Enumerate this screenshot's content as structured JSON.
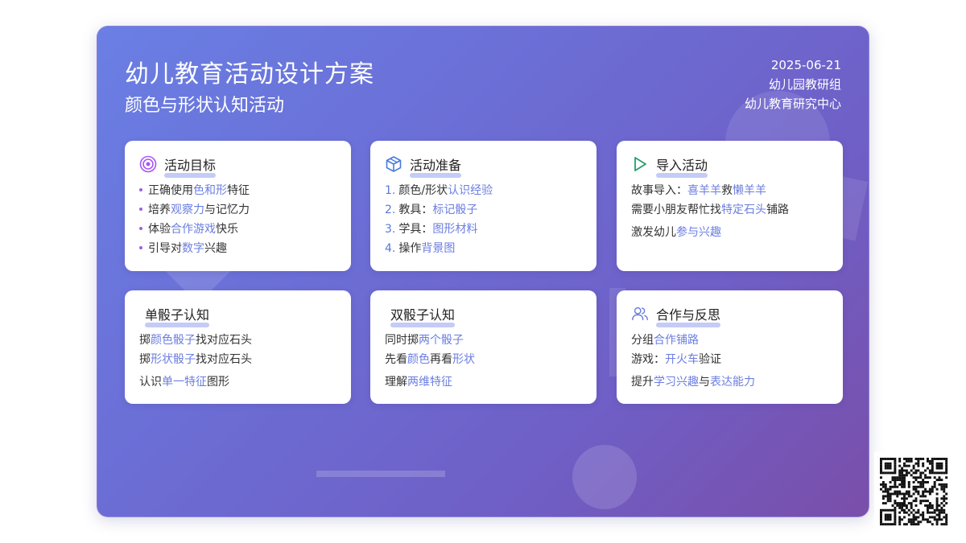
{
  "header": {
    "title": "幼儿教育活动设计方案",
    "subtitle": "颜色与形状认知活动",
    "date": "2025-06-21",
    "org": "幼儿园教研组",
    "center": "幼儿教育研究中心"
  },
  "cards": [
    {
      "title": "活动目标",
      "icon": "target-icon",
      "lines": [
        {
          "pre": "正确使用",
          "hl": "色和形",
          "post": "特征"
        },
        {
          "pre": "培养",
          "hl": "观察力",
          "post": "与记忆力"
        },
        {
          "pre": "体验",
          "hl": "合作游戏",
          "post": "快乐"
        },
        {
          "pre": "引导对",
          "hl": "数字",
          "post": "兴趣"
        }
      ]
    },
    {
      "title": "活动准备",
      "icon": "box-icon",
      "lines": [
        {
          "num": "1.",
          "pre": "颜色/形状",
          "hl": "认识经验",
          "post": ""
        },
        {
          "num": "2.",
          "pre": "教具：",
          "hl": "标记骰子",
          "post": ""
        },
        {
          "num": "3.",
          "pre": "学具：",
          "hl": "图形材料",
          "post": ""
        },
        {
          "num": "4.",
          "pre": "操作",
          "hl": "背景图",
          "post": ""
        }
      ]
    },
    {
      "title": "导入活动",
      "icon": "play-icon",
      "lines": [
        {
          "pre": "故事导入：",
          "hl": "喜羊羊",
          "post": "救",
          "hl2": "懒羊羊",
          "post2": ""
        },
        {
          "pre": "需要小朋友帮忙找",
          "hl": "特定石头",
          "post": "铺路"
        },
        {
          "pre": "激发幼儿",
          "hl": "参与兴趣",
          "post": ""
        }
      ]
    },
    {
      "title": "单骰子认知",
      "icon": "",
      "lines": [
        {
          "pre": "掷",
          "hl": "颜色骰子",
          "post": "找对应石头"
        },
        {
          "pre": "掷",
          "hl": "形状骰子",
          "post": "找对应石头"
        },
        {
          "pre": "认识",
          "hl": "单一特征",
          "post": "图形"
        }
      ]
    },
    {
      "title": "双骰子认知",
      "icon": "",
      "lines": [
        {
          "pre": "同时掷",
          "hl": "两个骰子",
          "post": ""
        },
        {
          "pre": "先看",
          "hl": "颜色",
          "post": "再看",
          "hl2": "形状",
          "post2": ""
        },
        {
          "pre": "理解",
          "hl": "两维特征",
          "post": ""
        }
      ]
    },
    {
      "title": "合作与反思",
      "icon": "users-icon",
      "lines": [
        {
          "pre": "分组",
          "hl": "合作铺路",
          "post": ""
        },
        {
          "pre": "游戏：",
          "hl": "开火车",
          "post": "验证"
        },
        {
          "pre": "提升",
          "hl": "学习兴趣",
          "post": "与",
          "hl2": "表达能力",
          "post2": ""
        }
      ]
    }
  ],
  "colors": {
    "accent": "#6b7ee0",
    "bullet": "#9a63d6",
    "underline": "#c4cbf6",
    "target_icon": "#a855f7",
    "box_icon": "#4a7bdc",
    "play_icon": "#22a06b",
    "users_icon": "#6b7ee0"
  },
  "qr": {
    "icon": "qr-code-icon"
  }
}
